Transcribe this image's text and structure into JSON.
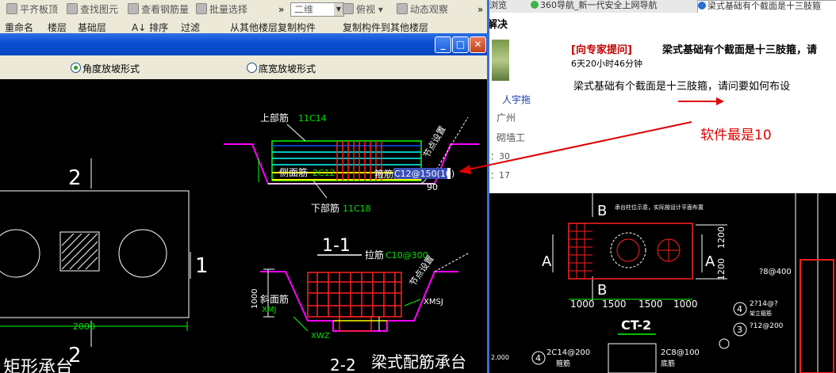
{
  "left_app": {
    "toolbar1": {
      "items": [
        {
          "label": "平齐板顶"
        },
        {
          "label": "查找图元"
        },
        {
          "label": "查看钢筋量"
        },
        {
          "label": "批量选择"
        }
      ],
      "overflow": "»",
      "view_dropdown": "二维",
      "angle_dropdown": "俯视",
      "dynamic_label": "动态观察"
    },
    "toolbar2": {
      "items": [
        "重命名",
        "楼层",
        "基础层",
        "A↓ 排序",
        "过滤",
        "从其他楼层复制构件",
        "复制构件到其他楼层"
      ]
    },
    "dialog": {
      "radio_angle": "角度放坡形式",
      "radio_width": "底宽放坡形式",
      "selected": "angle"
    },
    "cad": {
      "section1": {
        "top_bar": "上部筋",
        "top_bar_value": "11C14",
        "side_bar": "侧面筋",
        "side_bar_value": "2C12",
        "stirrup": "箍筋",
        "stirrup_value": "C12@150(10)",
        "bottom_bar": "下部筋",
        "bottom_bar_value": "11C18",
        "node_setting": "节点设置",
        "angle": "90",
        "title": "1-1"
      },
      "section2": {
        "tie_bar": "拉筋",
        "tie_bar_value": "C10@300",
        "slope_bar": "斜面筋",
        "xmj": "XMJ",
        "xmsj": "XMSJ",
        "xwz": "XWZ",
        "dim_1000": "1000",
        "node_setting": "节点设置",
        "title": "梁式配筋承台",
        "title_num": "2-2"
      },
      "plan": {
        "label_top": "2",
        "label_bottom": "2",
        "label_right": "1",
        "dim_bottom": "2000",
        "caption": "矩形承台"
      }
    }
  },
  "right_app": {
    "tabs": [
      {
        "label": "浏览"
      },
      {
        "label": "360导航_新一代安全上网导航"
      },
      {
        "label": "梁式基础有个截面是十三肢箍"
      }
    ],
    "qa": {
      "heading": "解决",
      "ask_expert": "[向专家提问]",
      "question_title": "梁式基础有个截面是十三肢箍，请",
      "time_ago": "6天20小时46分钟",
      "question_body": "梁式基础有个截面是十三肢箍，请问要如何布设",
      "user_name": "人宇拖",
      "location": "广州",
      "job": "砌墙工",
      "stat1": "：30",
      "stat2": "：17",
      "annotation": "软件最是10"
    },
    "diagram": {
      "label_b_top": "B",
      "label_b_bottom": "B",
      "label_a_left": "A",
      "label_a_right": "A",
      "note": "承台柱位示意，实际按设计平面布置",
      "dim_1200_a": "1200",
      "dim_1200_b": "1200",
      "dims_bottom": [
        "1000",
        "1500",
        "1500",
        "1000"
      ],
      "title": "CT-2",
      "left_small": "2,000",
      "label_2c14_200": "2C14@200",
      "label_2c8_100": "2C8@100",
      "label_hoop": "箍筋",
      "label_bottom_bar": "底筋",
      "circle4": "4",
      "circle4b": "4",
      "circle3": "3",
      "r_8_400": "?8@400",
      "r_2c14": "2?14@?",
      "r_mid": "架立箍筋",
      "r_12": "?12@200"
    }
  },
  "colors": {
    "cad_bg": "#000000",
    "cad_line": "#ffffff",
    "rebar_green": "#00ff00",
    "rebar_red": "#ff2020",
    "rebar_yellow": "#ffff00",
    "rebar_cyan": "#00ffff",
    "rebar_magenta": "#ff00ff",
    "rebar_blue": "#0050ff",
    "text_green": "#00e000",
    "annotation_red": "#e00000",
    "title_blue": "#0a4fd3"
  }
}
